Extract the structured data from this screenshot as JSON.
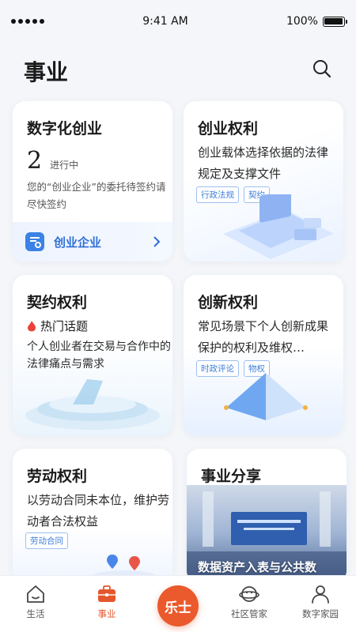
{
  "status": {
    "time": "9:41 AM",
    "battery": "100%"
  },
  "header": {
    "title": "事业"
  },
  "cards": {
    "entrepreneurship": {
      "title": "数字化创业",
      "count": "2",
      "count_label": "进行中",
      "note": "您的“创业企业”的委托待签约请尽快签约",
      "footer_label": "创业企业"
    },
    "rights": {
      "title": "创业权利",
      "desc": "创业载体选择依据的法律规定及支撑文件",
      "tags": [
        "行政法规",
        "契约"
      ]
    },
    "contract": {
      "title": "契约权利",
      "hot_label": "热门话题",
      "desc": "个人创业者在交易与合作中的法律痛点与需求"
    },
    "innovation": {
      "title": "创新权利",
      "desc": "常见场景下个人创新成果保护的权利及维权…",
      "tags": [
        "时政评论",
        "物权"
      ]
    },
    "labor": {
      "title": "劳动权利",
      "desc": "以劳动合同未本位，维护劳动者合法权益",
      "tags": [
        "劳动合同"
      ]
    },
    "share": {
      "title": "事业分享",
      "caption": "数据资产入表与公共数"
    }
  },
  "tabbar": {
    "items": [
      {
        "label": "生活",
        "icon": "home-icon"
      },
      {
        "label": "事业",
        "icon": "briefcase-icon"
      },
      {
        "label": "乐士",
        "icon": "center-logo"
      },
      {
        "label": "社区管家",
        "icon": "planet-icon"
      },
      {
        "label": "数字家园",
        "icon": "person-icon"
      }
    ]
  },
  "colors": {
    "accent": "#ea5a2c",
    "primary_blue": "#2e6fd6",
    "tag_blue": "#3f7fd9"
  }
}
